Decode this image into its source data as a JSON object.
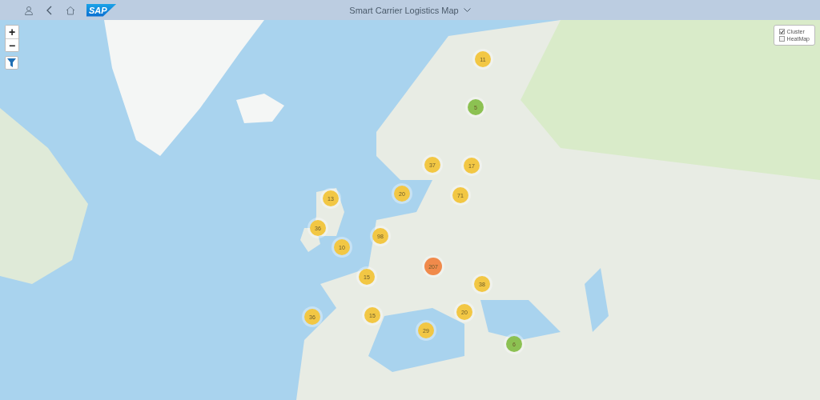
{
  "header": {
    "logo": "SAP",
    "title": "Smart Carrier Logistics Map"
  },
  "map_controls": {
    "zoom_in": "+",
    "zoom_out": "−"
  },
  "layers": [
    {
      "label": "Cluster",
      "checked": true
    },
    {
      "label": "HeatMap",
      "checked": false
    }
  ],
  "clusters": [
    {
      "count": "11",
      "color": "#f2c744"
    },
    {
      "count": "5",
      "color": "#8cc152"
    },
    {
      "count": "37",
      "color": "#f2c744"
    },
    {
      "count": "17",
      "color": "#f2c744"
    },
    {
      "count": "13",
      "color": "#f2c744"
    },
    {
      "count": "20",
      "color": "#f2c744"
    },
    {
      "count": "71",
      "color": "#f2c744"
    },
    {
      "count": "36",
      "color": "#f2c744"
    },
    {
      "count": "98",
      "color": "#f2c744"
    },
    {
      "count": "10",
      "color": "#f2c744"
    },
    {
      "count": "207",
      "color": "#f08a4b"
    },
    {
      "count": "15",
      "color": "#f2c744"
    },
    {
      "count": "38",
      "color": "#f2c744"
    },
    {
      "count": "36",
      "color": "#f2c744"
    },
    {
      "count": "15",
      "color": "#f2c744"
    },
    {
      "count": "20",
      "color": "#f2c744"
    },
    {
      "count": "29",
      "color": "#f2c744"
    },
    {
      "count": "6",
      "color": "#8cc152"
    }
  ]
}
